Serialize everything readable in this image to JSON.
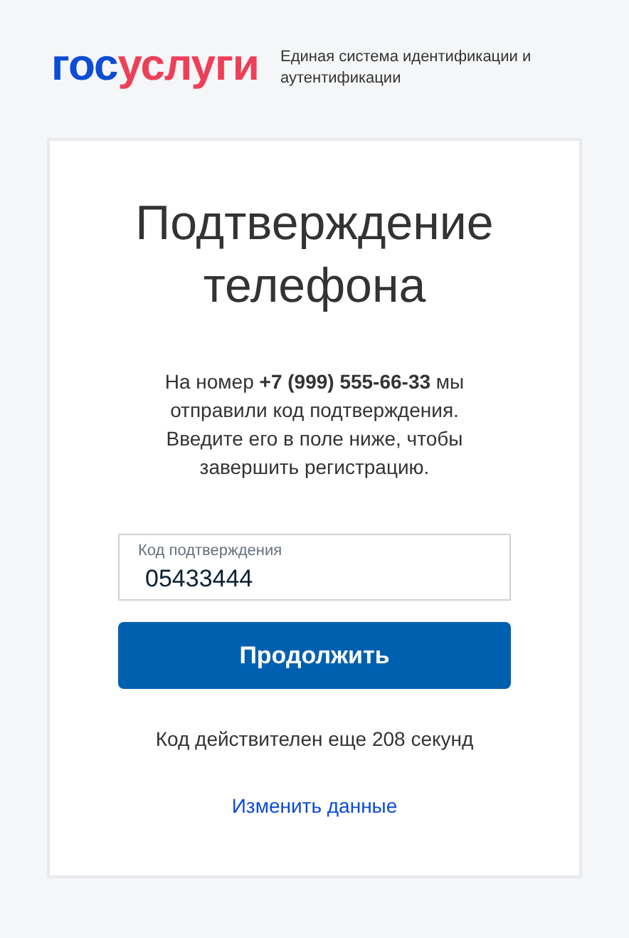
{
  "header": {
    "logo_primary": "гос",
    "logo_secondary": "услуги",
    "tagline": "Единая система идентификации и аутентификации"
  },
  "card": {
    "title": "Подтверждение телефона",
    "message": "На номер **+7 (999) 555-66-33** мы отправили код подтверждения. Введите его в поле ниже, чтобы завершить регистрацию.",
    "code_field": {
      "label": "Код подтверждения",
      "value": "05433444"
    },
    "continue_button": "Продолжить",
    "timer": "Код действителен еще 208 секунд",
    "change_link": "Изменить данные"
  }
}
